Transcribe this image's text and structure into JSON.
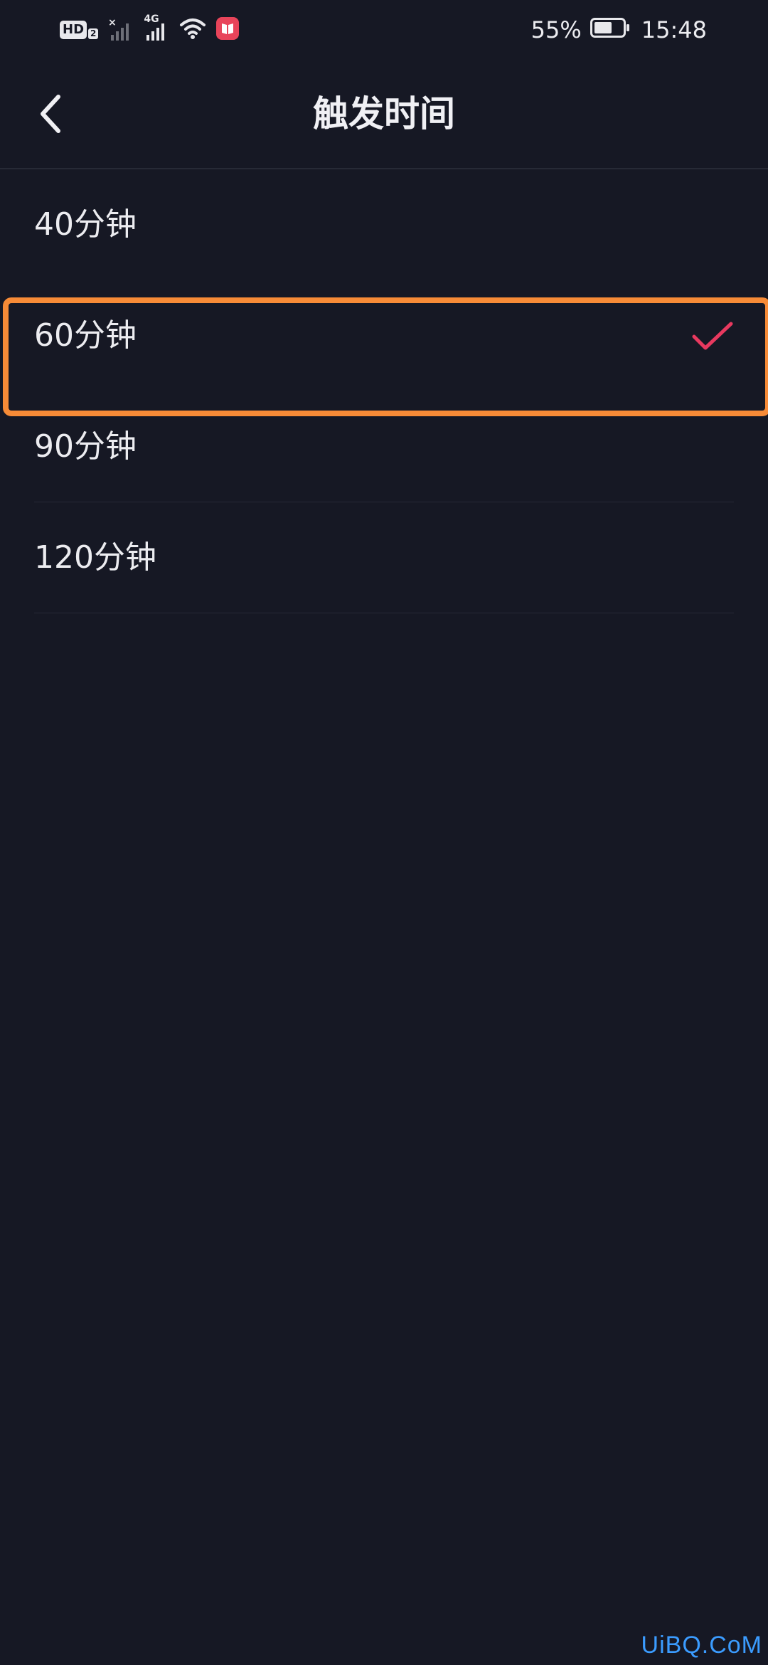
{
  "status_bar": {
    "hd_label": "HD",
    "hd_sub": "2",
    "network_type": "4G",
    "battery_percent": "55%",
    "time": "15:48",
    "icons": [
      "hd-icon",
      "signal-no-service-icon",
      "signal-4g-icon",
      "wifi-icon",
      "notification-app-icon",
      "battery-icon"
    ]
  },
  "header": {
    "title": "触发时间",
    "back_icon": "chevron-left-icon"
  },
  "options": [
    {
      "label": "40分钟",
      "selected": false
    },
    {
      "label": "60分钟",
      "selected": true
    },
    {
      "label": "90分钟",
      "selected": false
    },
    {
      "label": "120分钟",
      "selected": false
    }
  ],
  "colors": {
    "background": "#161824",
    "text": "#ececf0",
    "check": "#e8395f",
    "highlight": "#f78b37",
    "watermark": "#3b9cff"
  },
  "watermark": "UiBQ.CoM"
}
